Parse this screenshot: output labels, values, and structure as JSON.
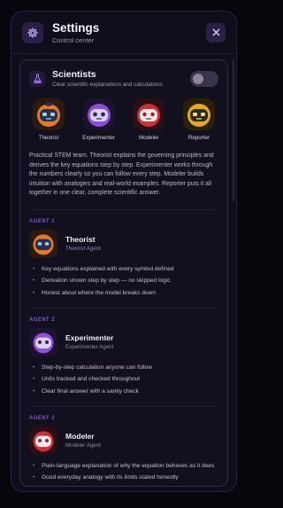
{
  "header": {
    "title": "Settings",
    "subtitle": "Control center",
    "icon": "gear-icon",
    "close_icon": "close-icon"
  },
  "team": {
    "title": "Scientists",
    "subtitle": "Clear scientific explanations and calculations",
    "icon": "flask-icon",
    "enabled": false,
    "members": [
      {
        "label": "Theorist"
      },
      {
        "label": "Experimenter"
      },
      {
        "label": "Modeler"
      },
      {
        "label": "Reporter"
      }
    ],
    "description": "Practical STEM team. Theorist explains the governing principles and derives the key equations step by step. Experimenter works through the numbers clearly so you can follow every step. Modeler builds intuition with analogies and real-world examples. Reporter puts it all together in one clear, complete scientific answer."
  },
  "agents": [
    {
      "tag": "AGENT 1",
      "name": "Theorist",
      "role": "Theorist Agent",
      "bullets": [
        "Key equations explained with every symbol defined",
        "Derivation shown step by step — no skipped logic",
        "Honest about where the model breaks down"
      ]
    },
    {
      "tag": "AGENT 2",
      "name": "Experimenter",
      "role": "Experimenter Agent",
      "bullets": [
        "Step-by-step calculation anyone can follow",
        "Units tracked and checked throughout",
        "Clear final answer with a sanity check"
      ]
    },
    {
      "tag": "AGENT 3",
      "name": "Modeler",
      "role": "Modeler Agent",
      "bullets": [
        "Plain-language explanation of why the equation behaves as it does",
        "Good everyday analogy with its limits stated honestly"
      ]
    }
  ],
  "colors": {
    "accent": "#7a57c8",
    "panel": "#100d1a",
    "theorist": "#e07a2e",
    "experimenter": "#8a4fd6",
    "modeler": "#c8323b",
    "reporter": "#e0a92a"
  }
}
